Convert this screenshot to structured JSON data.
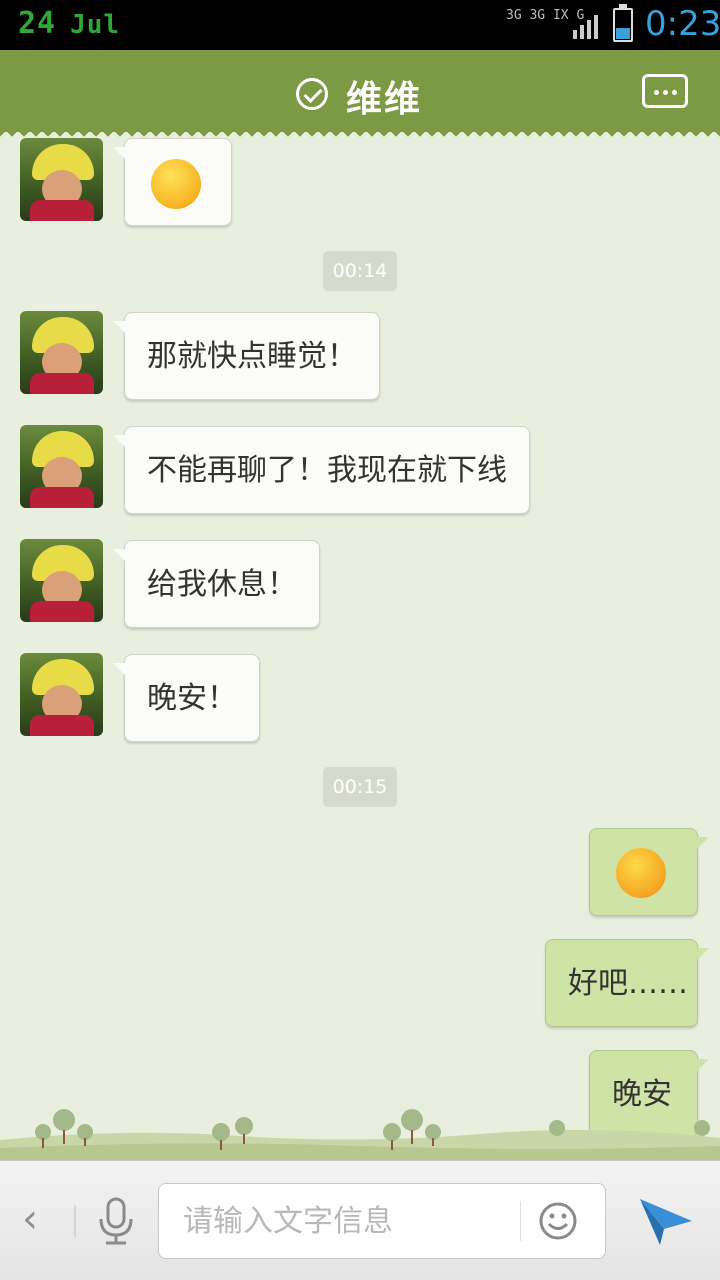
{
  "status_bar": {
    "day": "24",
    "month": "Jul",
    "network": "3G 3G IX G",
    "time": "0:23"
  },
  "header": {
    "title": "维维",
    "verified_icon": "check-circle-icon",
    "more_icon": "chat-more-icon"
  },
  "timestamps": [
    "00:14",
    "00:15"
  ],
  "messages_received": [
    {
      "text": "那就快点睡觉！"
    },
    {
      "text": "不能再聊了！我现在就下线"
    },
    {
      "text": "给我休息！"
    },
    {
      "text": "晚安！"
    }
  ],
  "messages_sent": [
    {
      "text": "好吧……"
    },
    {
      "text": "晚安"
    }
  ],
  "input": {
    "placeholder": "请输入文字信息"
  },
  "colors": {
    "header": "#7c9a43",
    "chat_background": "#e9efdf",
    "received_bubble": "#fbfcf8",
    "sent_bubble": "#cfe3a6",
    "send_icon": "#3a8fd6"
  }
}
